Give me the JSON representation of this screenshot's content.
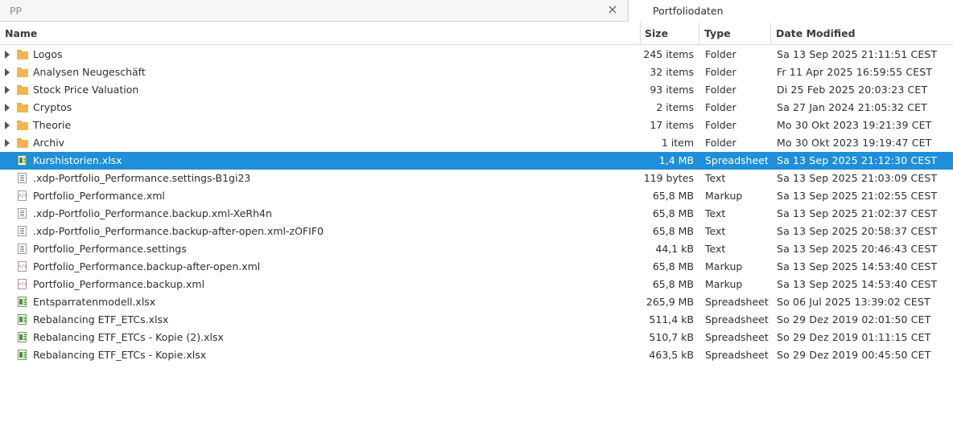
{
  "tabs": {
    "left": {
      "title": "PP",
      "close_glyph": "×"
    },
    "right": {
      "title": "Portfoliodaten"
    }
  },
  "columns": {
    "name": "Name",
    "size": "Size",
    "type": "Type",
    "date": "Date Modified"
  },
  "selected_color": "#1e8fd8",
  "files": [
    {
      "name": "Logos",
      "size": "245 items",
      "type": "Folder",
      "date": "Sa 13 Sep 2025 21:11:51 CEST",
      "icon": "folder-icon",
      "kind": "folder"
    },
    {
      "name": "Analysen Neugeschäft",
      "size": "32 items",
      "type": "Folder",
      "date": "Fr 11 Apr 2025 16:59:55 CEST",
      "icon": "folder-icon",
      "kind": "folder"
    },
    {
      "name": "Stock Price Valuation",
      "size": "93 items",
      "type": "Folder",
      "date": "Di 25 Feb 2025 20:03:23 CET",
      "icon": "folder-icon",
      "kind": "folder"
    },
    {
      "name": "Cryptos",
      "size": "2 items",
      "type": "Folder",
      "date": "Sa 27 Jan 2024 21:05:32 CET",
      "icon": "folder-icon",
      "kind": "folder"
    },
    {
      "name": "Theorie",
      "size": "17 items",
      "type": "Folder",
      "date": "Mo 30 Okt 2023 19:21:39 CET",
      "icon": "folder-icon",
      "kind": "folder"
    },
    {
      "name": "Archiv",
      "size": "1 item",
      "type": "Folder",
      "date": "Mo 30 Okt 2023 19:19:47 CET",
      "icon": "folder-icon",
      "kind": "folder"
    },
    {
      "name": "Kurshistorien.xlsx",
      "size": "1,4 MB",
      "type": "Spreadsheet",
      "date": "Sa 13 Sep 2025 21:12:30 CEST",
      "icon": "spreadsheet-icon",
      "kind": "sheet",
      "selected": true
    },
    {
      "name": ".xdp-Portfolio_Performance.settings-B1gi23",
      "size": "119 bytes",
      "type": "Text",
      "date": "Sa 13 Sep 2025 21:03:09 CEST",
      "icon": "text-file-icon",
      "kind": "text"
    },
    {
      "name": "Portfolio_Performance.xml",
      "size": "65,8 MB",
      "type": "Markup",
      "date": "Sa 13 Sep 2025 21:02:55 CEST",
      "icon": "markup-file-icon",
      "kind": "markup"
    },
    {
      "name": ".xdp-Portfolio_Performance.backup.xml-XeRh4n",
      "size": "65,8 MB",
      "type": "Text",
      "date": "Sa 13 Sep 2025 21:02:37 CEST",
      "icon": "text-file-icon",
      "kind": "text"
    },
    {
      "name": ".xdp-Portfolio_Performance.backup-after-open.xml-zOFIF0",
      "size": "65,8 MB",
      "type": "Text",
      "date": "Sa 13 Sep 2025 20:58:37 CEST",
      "icon": "text-file-icon",
      "kind": "text"
    },
    {
      "name": "Portfolio_Performance.settings",
      "size": "44,1 kB",
      "type": "Text",
      "date": "Sa 13 Sep 2025 20:46:43 CEST",
      "icon": "text-file-icon",
      "kind": "text"
    },
    {
      "name": "Portfolio_Performance.backup-after-open.xml",
      "size": "65,8 MB",
      "type": "Markup",
      "date": "Sa 13 Sep 2025 14:53:40 CEST",
      "icon": "markup-file-icon",
      "kind": "markup"
    },
    {
      "name": "Portfolio_Performance.backup.xml",
      "size": "65,8 MB",
      "type": "Markup",
      "date": "Sa 13 Sep 2025 14:53:40 CEST",
      "icon": "markup-file-icon",
      "kind": "markup"
    },
    {
      "name": "Entsparratenmodell.xlsx",
      "size": "265,9 MB",
      "type": "Spreadsheet",
      "date": "So 06 Jul 2025 13:39:02 CEST",
      "icon": "spreadsheet-icon",
      "kind": "sheet"
    },
    {
      "name": "Rebalancing ETF_ETCs.xlsx",
      "size": "511,4 kB",
      "type": "Spreadsheet",
      "date": "So 29 Dez 2019 02:01:50 CET",
      "icon": "spreadsheet-icon",
      "kind": "sheet"
    },
    {
      "name": "Rebalancing ETF_ETCs - Kopie (2).xlsx",
      "size": "510,7 kB",
      "type": "Spreadsheet",
      "date": "So 29 Dez 2019 01:11:15 CET",
      "icon": "spreadsheet-icon",
      "kind": "sheet"
    },
    {
      "name": "Rebalancing ETF_ETCs - Kopie.xlsx",
      "size": "463,5 kB",
      "type": "Spreadsheet",
      "date": "So 29 Dez 2019 00:45:50 CET",
      "icon": "spreadsheet-icon",
      "kind": "sheet"
    }
  ]
}
